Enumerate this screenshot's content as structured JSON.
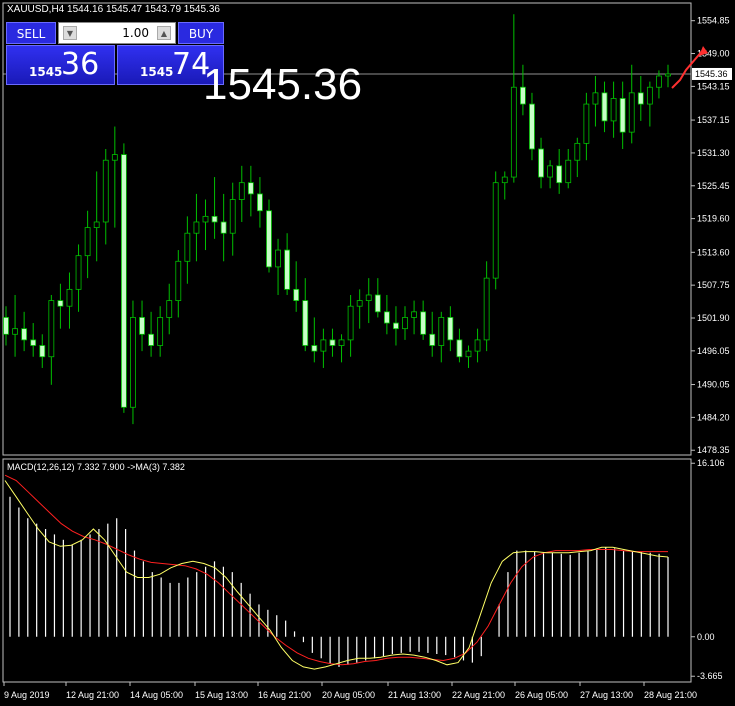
{
  "symbol_header": {
    "text": "XAUUSD,H4  1544.16 1545.47 1543.79 1545.36"
  },
  "trade_panel": {
    "sell_label": "SELL",
    "buy_label": "BUY",
    "lot_value": "1.00",
    "sell_price_prefix": "1545",
    "sell_price_big": "36",
    "buy_price_prefix": "1545",
    "buy_price_big": "74"
  },
  "big_price": "1545.36",
  "macd": {
    "label": "MACD(12,26,12) 7.332 7.900  ->MA(3) 7.382"
  },
  "colors": {
    "background": "#000000",
    "candle_up_fill": "#c8ffc8",
    "candle_wick": "#00c000",
    "macd_hist": "#ffffff",
    "macd_signal_yellow": "#ffff66",
    "macd_ma_red": "#ff2020",
    "price_line": "#c0c0c0",
    "panel_blue": "#2a2ae0"
  },
  "chart_data": {
    "type": "candlestick",
    "price_axis_ticks": [
      "1554.85",
      "1549.00",
      "1543.15",
      "1537.15",
      "1531.30",
      "1525.45",
      "1519.60",
      "1513.60",
      "1507.75",
      "1501.90",
      "1496.05",
      "1490.05",
      "1484.20",
      "1478.35"
    ],
    "current_price_label": "1545.36",
    "macd_axis_ticks": [
      "16.106",
      "0.00",
      "-3.665"
    ],
    "time_axis_labels": [
      "9 Aug 2019",
      "12 Aug 21:00",
      "14 Aug 05:00",
      "15 Aug 13:00",
      "16 Aug 21:00",
      "20 Aug 05:00",
      "21 Aug 13:00",
      "22 Aug 21:00",
      "26 Aug 05:00",
      "27 Aug 13:00",
      "28 Aug 21:00"
    ],
    "candles": [
      [
        1502,
        1504,
        1497,
        1499
      ],
      [
        1499,
        1506,
        1495,
        1500
      ],
      [
        1500,
        1503,
        1496,
        1498
      ],
      [
        1498,
        1501,
        1495,
        1497
      ],
      [
        1497,
        1499,
        1493,
        1495
      ],
      [
        1495,
        1506,
        1490,
        1505
      ],
      [
        1505,
        1508,
        1500,
        1504
      ],
      [
        1504,
        1510,
        1500,
        1507
      ],
      [
        1507,
        1515,
        1503,
        1513
      ],
      [
        1513,
        1521,
        1509,
        1518
      ],
      [
        1518,
        1528,
        1512,
        1519
      ],
      [
        1519,
        1532,
        1515,
        1530
      ],
      [
        1530,
        1536,
        1518,
        1531
      ],
      [
        1531,
        1533,
        1485,
        1486
      ],
      [
        1486,
        1505,
        1483,
        1502
      ],
      [
        1502,
        1505,
        1496,
        1499
      ],
      [
        1499,
        1503,
        1495,
        1497
      ],
      [
        1497,
        1504,
        1495,
        1502
      ],
      [
        1502,
        1508,
        1499,
        1505
      ],
      [
        1505,
        1514,
        1502,
        1512
      ],
      [
        1512,
        1520,
        1508,
        1517
      ],
      [
        1517,
        1524,
        1512,
        1519
      ],
      [
        1519,
        1523,
        1514,
        1520
      ],
      [
        1520,
        1527,
        1516,
        1519
      ],
      [
        1519,
        1524,
        1512,
        1517
      ],
      [
        1517,
        1526,
        1513,
        1523
      ],
      [
        1523,
        1529,
        1519,
        1526
      ],
      [
        1526,
        1529,
        1520,
        1524
      ],
      [
        1524,
        1527,
        1518,
        1521
      ],
      [
        1521,
        1523,
        1510,
        1511
      ],
      [
        1511,
        1516,
        1506,
        1514
      ],
      [
        1514,
        1517,
        1506,
        1507
      ],
      [
        1507,
        1512,
        1503,
        1505
      ],
      [
        1505,
        1509,
        1496,
        1497
      ],
      [
        1497,
        1502,
        1494,
        1496
      ],
      [
        1496,
        1500,
        1493,
        1498
      ],
      [
        1498,
        1500,
        1495,
        1497
      ],
      [
        1497,
        1499,
        1494,
        1498
      ],
      [
        1498,
        1506,
        1495,
        1504
      ],
      [
        1504,
        1507,
        1500,
        1505
      ],
      [
        1505,
        1509,
        1501,
        1506
      ],
      [
        1506,
        1509,
        1502,
        1503
      ],
      [
        1503,
        1506,
        1499,
        1501
      ],
      [
        1501,
        1504,
        1497,
        1500
      ],
      [
        1500,
        1504,
        1498,
        1502
      ],
      [
        1502,
        1505,
        1499,
        1503
      ],
      [
        1503,
        1505,
        1498,
        1499
      ],
      [
        1499,
        1503,
        1495,
        1497
      ],
      [
        1497,
        1503,
        1494,
        1502
      ],
      [
        1502,
        1504,
        1496,
        1498
      ],
      [
        1498,
        1500,
        1494,
        1495
      ],
      [
        1495,
        1497,
        1493,
        1496
      ],
      [
        1496,
        1500,
        1494,
        1498
      ],
      [
        1498,
        1512,
        1496,
        1509
      ],
      [
        1509,
        1528,
        1507,
        1526
      ],
      [
        1526,
        1528,
        1523,
        1527
      ],
      [
        1527,
        1556,
        1526,
        1543
      ],
      [
        1543,
        1547,
        1538,
        1540
      ],
      [
        1540,
        1542,
        1530,
        1532
      ],
      [
        1532,
        1534,
        1525,
        1527
      ],
      [
        1527,
        1530,
        1525,
        1529
      ],
      [
        1529,
        1532,
        1524,
        1526
      ],
      [
        1526,
        1532,
        1525,
        1530
      ],
      [
        1530,
        1534,
        1527,
        1533
      ],
      [
        1533,
        1542,
        1530,
        1540
      ],
      [
        1540,
        1545,
        1536,
        1542
      ],
      [
        1542,
        1544,
        1535,
        1537
      ],
      [
        1537,
        1544,
        1534,
        1541
      ],
      [
        1541,
        1544,
        1532,
        1535
      ],
      [
        1535,
        1547,
        1533,
        1542
      ],
      [
        1542,
        1545,
        1537,
        1540
      ],
      [
        1540,
        1544,
        1536,
        1543
      ],
      [
        1543,
        1546,
        1541,
        1545
      ],
      [
        1545,
        1547,
        1543,
        1545.36
      ]
    ],
    "macd_hist": [
      13,
      12,
      11,
      10.5,
      10,
      9.5,
      9,
      8.5,
      9,
      9.5,
      10,
      10.5,
      11,
      10,
      8,
      7,
      6,
      5.5,
      5,
      5,
      5.5,
      6,
      6.5,
      7,
      6.5,
      6,
      5,
      4,
      3,
      2.5,
      2,
      1.5,
      0.5,
      -0.5,
      -1.5,
      -2,
      -2.5,
      -2.8,
      -2.6,
      -2.4,
      -2.2,
      -2,
      -1.8,
      -1.6,
      -1.5,
      -1.4,
      -1.4,
      -1.5,
      -1.6,
      -1.7,
      -1.9,
      -2.2,
      -2.4,
      -1.8,
      0,
      3,
      6,
      8,
      8,
      7.9,
      7.8,
      7.8,
      7.7,
      7.6,
      7.8,
      8,
      8.2,
      8.3,
      8.2,
      8,
      7.9,
      7.9,
      7.8,
      7.7,
      7.4
    ],
    "macd_signal_yellow": [
      14.5,
      13,
      11.5,
      10,
      8.8,
      8.4,
      8.5,
      9,
      10,
      9,
      7.5,
      6,
      5.5,
      5.5,
      5.8,
      6.4,
      6.8,
      7,
      6.8,
      6.4,
      5.5,
      4.2,
      3,
      1.8,
      0.6,
      -1,
      -2.2,
      -2.8,
      -3,
      -2.8,
      -2.5,
      -2.2,
      -2,
      -2,
      -1.9,
      -1.7,
      -1.6,
      -1.7,
      -1.9,
      -2.2,
      -2.6,
      -2.4,
      -1,
      2,
      5,
      7,
      7.8,
      7.9,
      7.9,
      7.8,
      7.8,
      7.8,
      7.9,
      8,
      8.3,
      8.3,
      8.1,
      7.9,
      7.7,
      7.5,
      7.4
    ],
    "macd_ma_red": [
      15,
      14.5,
      13.5,
      12.5,
      11.5,
      10.5,
      9.8,
      9.3,
      9,
      8.6,
      8.1,
      7.6,
      7.2,
      6.9,
      6.8,
      6.7,
      6.6,
      6.3,
      5.8,
      5,
      4,
      3,
      2,
      1,
      0,
      -0.8,
      -1.5,
      -2,
      -2.3,
      -2.5,
      -2.6,
      -2.5,
      -2.3,
      -2.2,
      -2,
      -1.9,
      -1.9,
      -2,
      -2.1,
      -2.2,
      -2,
      -1.5,
      -0.5,
      1,
      3,
      5,
      6.5,
      7.4,
      7.8,
      8,
      8,
      8,
      8.1,
      8.1,
      8.1,
      8,
      7.9,
      7.9,
      7.9,
      7.9
    ],
    "price_range": [
      1477.5,
      1558
    ],
    "macd_range": [
      -4.2,
      16.5
    ]
  }
}
